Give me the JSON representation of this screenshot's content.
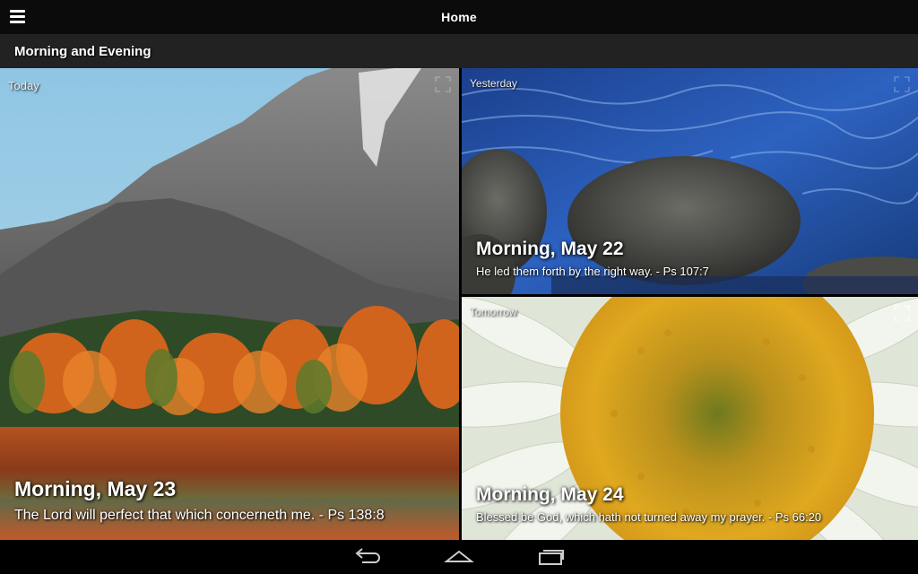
{
  "action_bar": {
    "title": "Home"
  },
  "section": {
    "title": "Morning and Evening"
  },
  "tiles": {
    "today": {
      "label": "Today",
      "heading": "Morning, May 23",
      "verse": "The Lord will perfect that which concerneth me. - Ps 138:8"
    },
    "yesterday": {
      "label": "Yesterday",
      "heading": "Morning, May 22",
      "verse": "He led them forth by the right way. - Ps 107:7"
    },
    "tomorrow": {
      "label": "Tomorrow",
      "heading": "Morning, May 24",
      "verse": "Blessed be God, which hath not turned away my prayer. - Ps 66:20"
    }
  },
  "icons": {
    "menu": "menu-icon",
    "expand": "expand-icon",
    "back": "back-icon",
    "home": "home-icon",
    "recent": "recent-apps-icon"
  }
}
